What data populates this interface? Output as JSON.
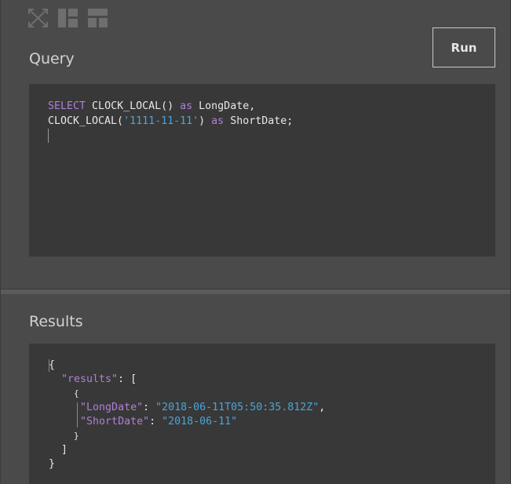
{
  "toolbar": {
    "icons": [
      "expand-icon",
      "layout-columns-icon",
      "layout-rows-icon"
    ]
  },
  "query_panel": {
    "title": "Query",
    "run_label": "Run",
    "code": {
      "line1": {
        "kw1": "SELECT",
        "t1": " CLOCK_LOCAL() ",
        "kw2": "as",
        "t2": " LongDate,"
      },
      "line2": {
        "t1": "CLOCK_LOCAL(",
        "str": "'1111-11-11'",
        "t2": ") ",
        "kw": "as",
        "t3": " ShortDate;"
      }
    }
  },
  "results_panel": {
    "title": "Results",
    "json": {
      "open_brace": "{",
      "results_key": "\"results\"",
      "colon_bracket": ": [",
      "inner_open": "{",
      "long_key": "\"LongDate\"",
      "long_value": "\"2018-06-11T05:50:35.812Z\"",
      "short_key": "\"ShortDate\"",
      "short_value": "\"2018-06-11\"",
      "colon": ": ",
      "comma": ",",
      "inner_close": "}",
      "close_bracket": "]",
      "close_brace": "}"
    }
  },
  "colors": {
    "keyword": "#b07fd6",
    "string": "#4aa5d8",
    "panel_bg": "#4a4a4a",
    "editor_bg": "#383838"
  }
}
